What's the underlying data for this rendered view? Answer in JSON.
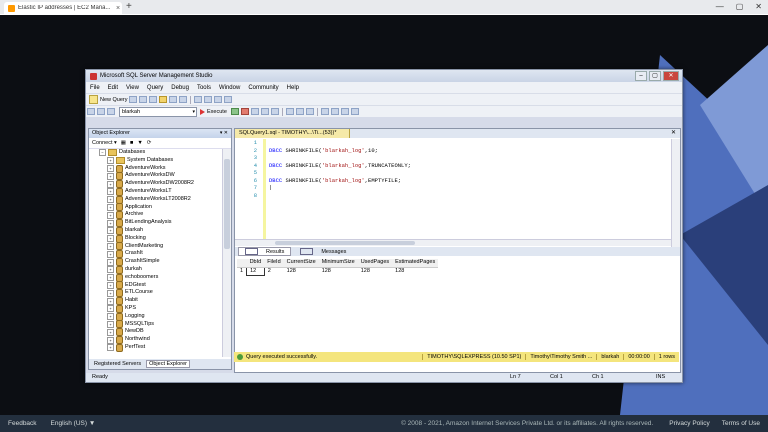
{
  "browser": {
    "tab_title": "Elastic IP addresses | EC2 Mana...",
    "close_glyph": "×",
    "new_tab_glyph": "+",
    "controls": [
      "—",
      "▢",
      "✕"
    ]
  },
  "ssms": {
    "title": "Microsoft SQL Server Management Studio",
    "window_controls": [
      "–",
      "▢",
      "✕"
    ],
    "menu": [
      "File",
      "Edit",
      "View",
      "Query",
      "Debug",
      "Tools",
      "Window",
      "Community",
      "Help"
    ],
    "toolbar": {
      "new_query": "New Query",
      "database": "blarkah",
      "execute": "Execute"
    },
    "object_explorer": {
      "title": "Object Explorer",
      "pin": "▾ ✕",
      "connect": "Connect ▾",
      "toolbar_icons": [
        "▦",
        "■",
        "▼",
        "⟳"
      ],
      "tree": [
        {
          "label": "Databases",
          "icon": "folder",
          "indent": 1,
          "expander": "−"
        },
        {
          "label": "System Databases",
          "icon": "folder",
          "indent": 2,
          "expander": "+"
        },
        {
          "label": "AdventureWorks",
          "icon": "database",
          "indent": 2,
          "expander": "+"
        },
        {
          "label": "AdventureWorksDW",
          "icon": "database",
          "indent": 2,
          "expander": "+"
        },
        {
          "label": "AdventureWorksDW2008R2",
          "icon": "database",
          "indent": 2,
          "expander": "+"
        },
        {
          "label": "AdventureWorksLT",
          "icon": "database",
          "indent": 2,
          "expander": "+"
        },
        {
          "label": "AdventureWorksLT2008R2",
          "icon": "database",
          "indent": 2,
          "expander": "+"
        },
        {
          "label": "Application",
          "icon": "database",
          "indent": 2,
          "expander": "+"
        },
        {
          "label": "Archive",
          "icon": "database",
          "indent": 2,
          "expander": "+"
        },
        {
          "label": "BitLendingAnalysis",
          "icon": "database",
          "indent": 2,
          "expander": "+"
        },
        {
          "label": "blarkah",
          "icon": "database",
          "indent": 2,
          "expander": "+"
        },
        {
          "label": "Blocking",
          "icon": "database",
          "indent": 2,
          "expander": "+"
        },
        {
          "label": "ClientMarketing",
          "icon": "database",
          "indent": 2,
          "expander": "+"
        },
        {
          "label": "CrashIt",
          "icon": "database",
          "indent": 2,
          "expander": "+"
        },
        {
          "label": "CrashItSimple",
          "icon": "database",
          "indent": 2,
          "expander": "+"
        },
        {
          "label": "durkah",
          "icon": "database",
          "indent": 2,
          "expander": "+"
        },
        {
          "label": "echoboomers",
          "icon": "database",
          "indent": 2,
          "expander": "+"
        },
        {
          "label": "EDGtest",
          "icon": "database",
          "indent": 2,
          "expander": "+"
        },
        {
          "label": "ETLCourse",
          "icon": "database",
          "indent": 2,
          "expander": "+"
        },
        {
          "label": "Habit",
          "icon": "database",
          "indent": 2,
          "expander": "+"
        },
        {
          "label": "KPS",
          "icon": "database",
          "indent": 2,
          "expander": "+"
        },
        {
          "label": "Logging",
          "icon": "database",
          "indent": 2,
          "expander": "+"
        },
        {
          "label": "MSSQLTips",
          "icon": "database",
          "indent": 2,
          "expander": "+"
        },
        {
          "label": "NewDB",
          "icon": "database",
          "indent": 2,
          "expander": "+"
        },
        {
          "label": "Northwind",
          "icon": "database",
          "indent": 2,
          "expander": "+"
        },
        {
          "label": "PerfTest",
          "icon": "database",
          "indent": 2,
          "expander": "+"
        }
      ],
      "tabs": [
        "Registered Servers",
        "Object Explorer"
      ]
    },
    "editor": {
      "tab_title": "SQLQuery1.sql - TIMOTHY\\...\\Ti...(53))*",
      "close_glyph": "✕",
      "line_numbers": [
        "1",
        "2",
        "3",
        "4",
        "5",
        "6",
        "7",
        "8"
      ],
      "lines": [
        [],
        [
          {
            "t": "DBCC",
            "c": "kw"
          },
          {
            "t": " SHRINKFILE(",
            "c": ""
          },
          {
            "t": "'blarkah_log'",
            "c": "str"
          },
          {
            "t": ",10;",
            "c": ""
          }
        ],
        [],
        [
          {
            "t": "DBCC",
            "c": "kw"
          },
          {
            "t": " SHRINKFILE(",
            "c": ""
          },
          {
            "t": "'blarkah_log'",
            "c": "str"
          },
          {
            "t": ",TRUNCATEONLY;",
            "c": ""
          }
        ],
        [],
        [
          {
            "t": "DBCC",
            "c": "kw"
          },
          {
            "t": " SHRINKFILE(",
            "c": ""
          },
          {
            "t": "'blarkah_log'",
            "c": "str"
          },
          {
            "t": ",EMPTYFILE;",
            "c": ""
          }
        ],
        [
          {
            "t": "|",
            "c": ""
          }
        ],
        []
      ]
    },
    "results": {
      "tabs": [
        "Results",
        "Messages"
      ],
      "columns": [
        "",
        "DbId",
        "FileId",
        "CurrentSize",
        "MinimumSize",
        "UsedPages",
        "EstimatedPages"
      ],
      "rows": [
        [
          "1",
          "12",
          "2",
          "128",
          "128",
          "128",
          "128"
        ]
      ]
    },
    "query_status": {
      "message": "Query executed successfully.",
      "server": "TIMOTHY\\SQLEXPRESS (10.50 SP1)",
      "user": "Timothy\\Timothy Smith ...",
      "database": "blarkah",
      "time": "00:00:00",
      "rows": "1 rows"
    },
    "status": {
      "ready": "Ready",
      "ln": "Ln 7",
      "col": "Col 1",
      "ch": "Ch 1",
      "ins": "INS"
    }
  },
  "footer": {
    "feedback": "Feedback",
    "language": "English (US) ▼",
    "copyright": "© 2008 - 2021, Amazon Internet Services Private Ltd. or its affiliates. All rights reserved.",
    "privacy": "Privacy Policy",
    "terms": "Terms of Use"
  },
  "colors": {
    "desktop_bg": "#0c0e13",
    "shape_light": "#7f9ad6",
    "shape_mid": "#4f6fbd",
    "shape_dark": "#2a3f7a",
    "footer_bg": "#232f3e"
  }
}
